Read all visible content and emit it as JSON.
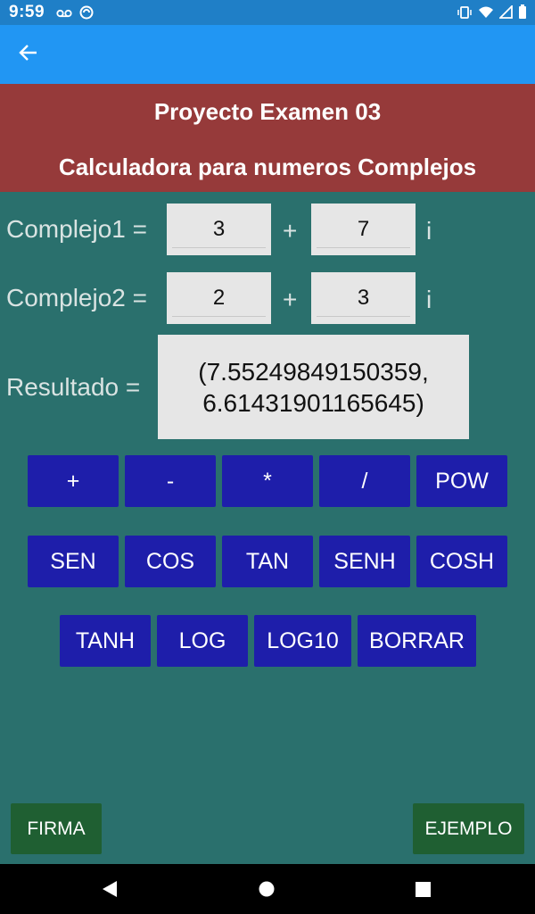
{
  "status": {
    "time": "9:59",
    "icons_left": [
      "voicemail-icon",
      "sync-icon"
    ],
    "icons_right": [
      "vibrate-icon",
      "wifi-icon",
      "signal-icon",
      "battery-icon"
    ]
  },
  "appbar": {
    "back_icon": "arrow-back-icon"
  },
  "header": {
    "title": "Proyecto Examen 03",
    "subtitle": "Calculadora para numeros Complejos"
  },
  "form": {
    "complejo1": {
      "label": "Complejo1 =",
      "real": "3",
      "plus": "+",
      "imag": "7",
      "i": "i"
    },
    "complejo2": {
      "label": "Complejo2 =",
      "real": "2",
      "plus": "+",
      "imag": "3",
      "i": "i"
    },
    "resultado": {
      "label": "Resultado =",
      "line1": "(7.55249849150359,",
      "line2": "6.61431901165645)"
    }
  },
  "buttons": {
    "row1": [
      "+",
      "-",
      "*",
      "/",
      "POW"
    ],
    "row2": [
      "SEN",
      "COS",
      "TAN",
      "SENH",
      "COSH"
    ],
    "row3": [
      "TANH",
      "LOG",
      "LOG10",
      "BORRAR"
    ]
  },
  "footer": {
    "firma": "FIRMA",
    "ejemplo": "EJEMPLO"
  },
  "colors": {
    "background": "#2a706d",
    "appbar": "#2196f3",
    "header": "#963a3a",
    "op_button": "#1e1eaa",
    "footer_button": "#1f5f32"
  }
}
